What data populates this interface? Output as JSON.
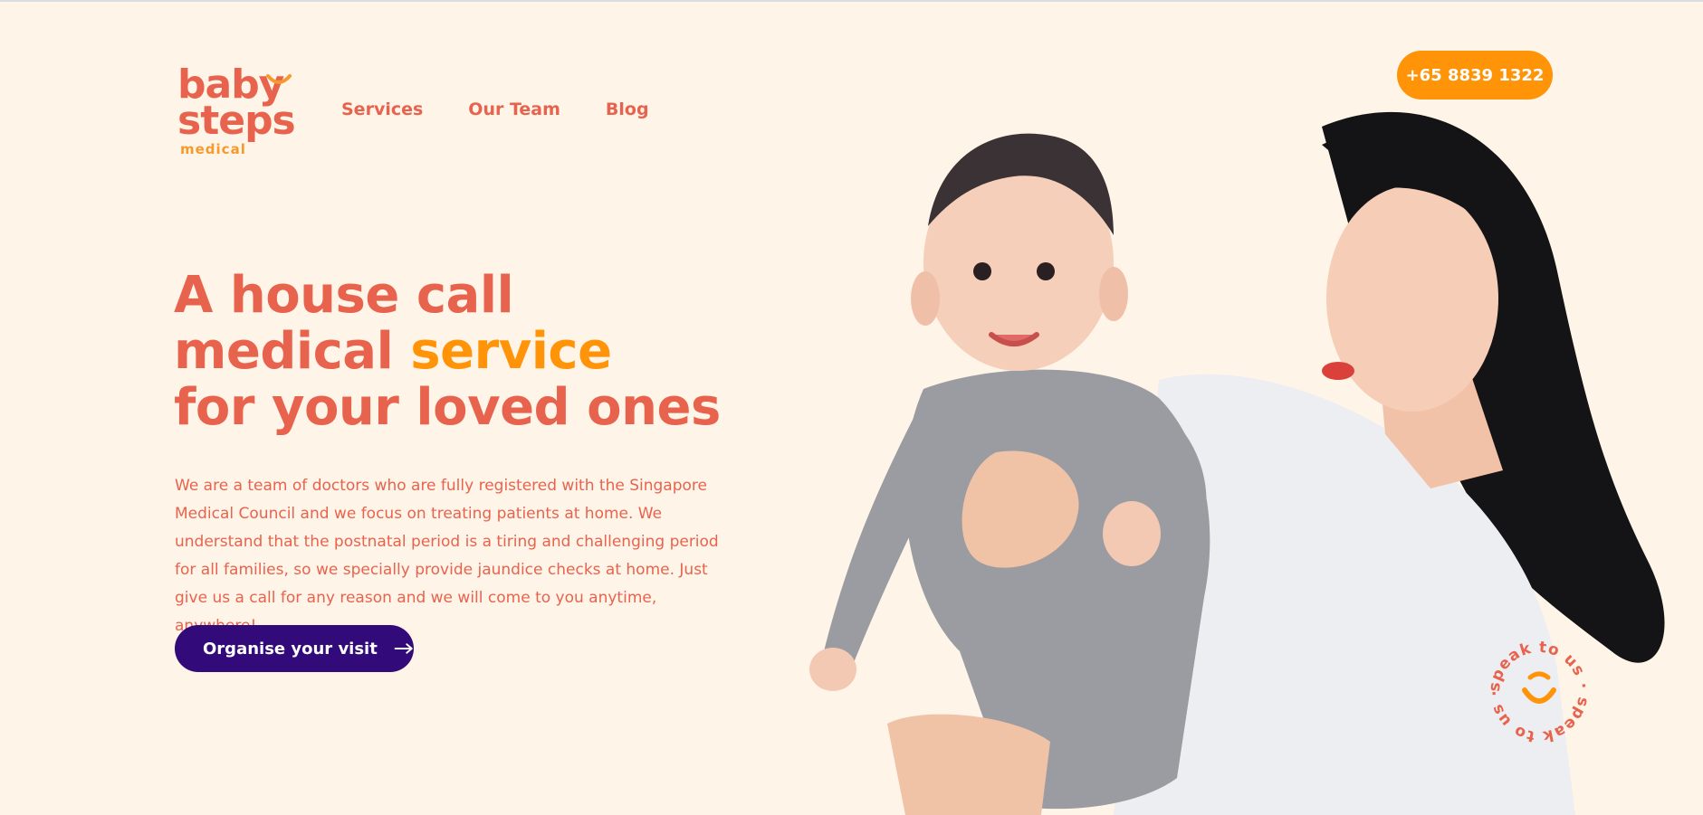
{
  "logo": {
    "line1": "baby",
    "line2": "steps",
    "line3": "medical"
  },
  "nav": {
    "items": [
      {
        "label": "Services"
      },
      {
        "label": "Our Team"
      },
      {
        "label": "Blog"
      }
    ]
  },
  "phone": {
    "label": "+65 8839 1322"
  },
  "hero": {
    "title_line1": "A house call",
    "title_line2_a": "medical ",
    "title_line2_b": "service",
    "title_line3": "for your loved ones",
    "description": "We are a team of doctors who are fully registered with the Singapore Medical Council and we focus on treating patients at home. We understand that the postnatal period is a tiring and challenging period for all families, so we specially provide jaundice checks at home. Just give us a call for any reason and we will come to you anytime, anywhere!",
    "cta_label": "Organise your visit"
  },
  "badge": {
    "text": "speak to us · speak to us ·"
  },
  "icons": {
    "cta": "arrow-right-icon",
    "badge": "smile-icon"
  },
  "colors": {
    "background": "#fff4e8",
    "primary": "#e8634d",
    "accent": "#ff9408",
    "cta": "#320a7a"
  }
}
